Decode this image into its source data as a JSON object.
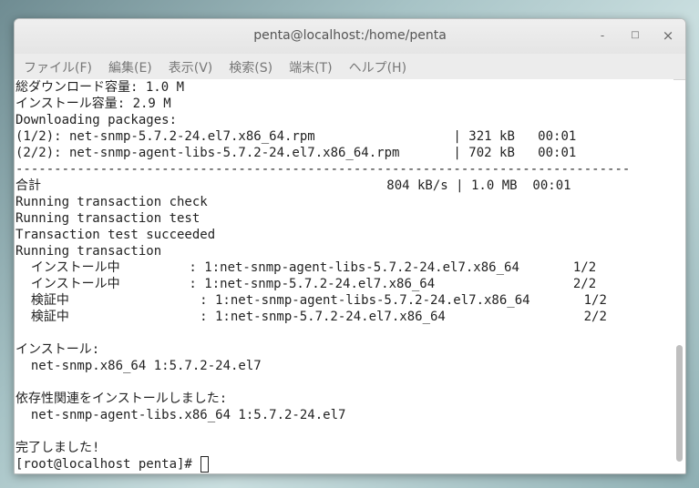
{
  "window": {
    "title": "penta@localhost:/home/penta",
    "minimize": "-",
    "maximize": "□",
    "close": "×"
  },
  "menu": [
    "ファイル(F)",
    "編集(E)",
    "表示(V)",
    "検索(S)",
    "端末(T)",
    "ヘルプ(H)"
  ],
  "terminal": {
    "lines": [
      "総ダウンロード容量: 1.0 M",
      "インストール容量: 2.9 M",
      "Downloading packages:",
      "(1/2): net-snmp-5.7.2-24.el7.x86_64.rpm                  | 321 kB   00:01",
      "(2/2): net-snmp-agent-libs-5.7.2-24.el7.x86_64.rpm       | 702 kB   00:01",
      "--------------------------------------------------------------------------------",
      "合計                                             804 kB/s | 1.0 MB  00:01",
      "Running transaction check",
      "Running transaction test",
      "Transaction test succeeded",
      "Running transaction",
      "  インストール中         : 1:net-snmp-agent-libs-5.7.2-24.el7.x86_64       1/2",
      "  インストール中         : 1:net-snmp-5.7.2-24.el7.x86_64                  2/2",
      "  検証中                 : 1:net-snmp-agent-libs-5.7.2-24.el7.x86_64       1/2",
      "  検証中                 : 1:net-snmp-5.7.2-24.el7.x86_64                  2/2",
      "",
      "インストール:",
      "  net-snmp.x86_64 1:5.7.2-24.el7",
      "",
      "依存性関連をインストールしました:",
      "  net-snmp-agent-libs.x86_64 1:5.7.2-24.el7",
      "",
      "完了しました!"
    ],
    "prompt": "[root@localhost penta]# "
  }
}
